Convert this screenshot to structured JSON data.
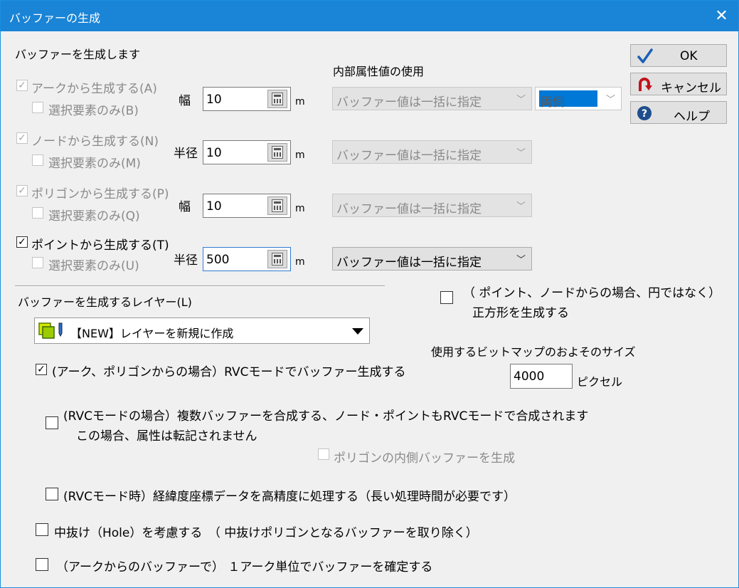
{
  "window": {
    "title": "バッファーの生成",
    "close_label": "✕"
  },
  "heading": "バッファーを生成します",
  "internal_attr_heading": "内部属性値の使用",
  "unit": "m",
  "sections": [
    {
      "main_label": "アークから生成する(A)",
      "main_checked": true,
      "sub_label": "選択要素のみ(B)",
      "size_label": "幅",
      "value": "10",
      "combo": "バッファー値は一括に指定"
    },
    {
      "main_label": "ノードから生成する(N)",
      "main_checked": true,
      "sub_label": "選択要素のみ(M)",
      "size_label": "半径",
      "value": "10",
      "combo": "バッファー値は一括に指定"
    },
    {
      "main_label": "ポリゴンから生成する(P)",
      "main_checked": true,
      "sub_label": "選択要素のみ(Q)",
      "size_label": "幅",
      "value": "10",
      "combo": "バッファー値は一括に指定"
    },
    {
      "main_label": "ポイントから生成する(T)",
      "main_checked": true,
      "sub_label": "選択要素のみ(U)",
      "size_label": "半径",
      "value": "500",
      "combo": "バッファー値は一括に指定"
    }
  ],
  "side_select": {
    "value": "両側"
  },
  "buttons": {
    "ok": "OK",
    "cancel": "キャンセル",
    "help": "ヘルプ"
  },
  "layer": {
    "label": "バッファーを生成するレイヤー(L)",
    "value": "【NEW】レイヤーを新規に作成"
  },
  "square_option": {
    "line1": "（ ポイント、ノードからの場合、円ではなく）",
    "line2": "正方形を生成する",
    "checked": false
  },
  "bitmap": {
    "label": "使用するビットマップのおよそのサイズ",
    "value": "4000",
    "unit": "ピクセル"
  },
  "options": {
    "rvc_mode": {
      "label": "(アーク、ポリゴンからの場合）RVCモードでバッファー生成する",
      "checked": true
    },
    "rvc_merge": {
      "line1": "(RVCモードの場合）複数バッファーを合成する、ノード・ポイントもRVCモードで合成されます",
      "line2": "この場合、属性は転記されません",
      "checked": false
    },
    "inner_buffer": {
      "label": "ポリゴンの内側バッファーを生成",
      "checked": false
    },
    "high_precision": {
      "label": "(RVCモード時）経緯度座標データを高精度に処理する（長い処理時間が必要です）",
      "checked": false
    },
    "hole": {
      "label": "中抜け（Hole）を考慮する　（ 中抜けポリゴンとなるバッファーを取り除く）",
      "checked": false
    },
    "per_arc": {
      "label": "（アークからのバッファーで） １アーク単位でバッファーを確定する",
      "checked": false
    }
  },
  "colors": {
    "titlebar": "#1a84d6",
    "ok_check": "#1a5fb4",
    "cancel_icon": "#c0141c",
    "help_icon": "#1f4e8c",
    "selection": "#0078d7"
  }
}
